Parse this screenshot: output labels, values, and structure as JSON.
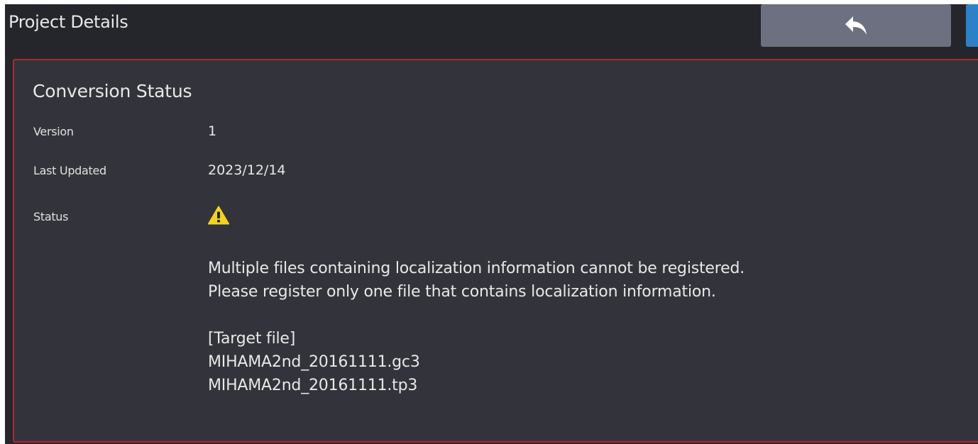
{
  "header": {
    "title": "Project Details",
    "back_icon": "reply-arrow-icon"
  },
  "panel": {
    "title": "Conversion Status",
    "fields": {
      "version": {
        "label": "Version",
        "value": "1"
      },
      "last_updated": {
        "label": "Last Updated",
        "value": "2023/12/14"
      },
      "status": {
        "label": "Status",
        "icon": "warning-icon"
      }
    },
    "message": {
      "line1": "Multiple files containing localization information cannot be registered.",
      "line2": "Please register only one file that contains localization information.",
      "target_header": "[Target file]",
      "files": [
        "MIHAMA2nd_20161111.gc3",
        "MIHAMA2nd_20161111.tp3"
      ]
    }
  },
  "colors": {
    "background": "#25262b",
    "panel": "#33343b",
    "panel_border": "#b3262d",
    "back_button": "#6d7080",
    "side_button": "#2c82c9",
    "warning": "#f5d31c"
  }
}
